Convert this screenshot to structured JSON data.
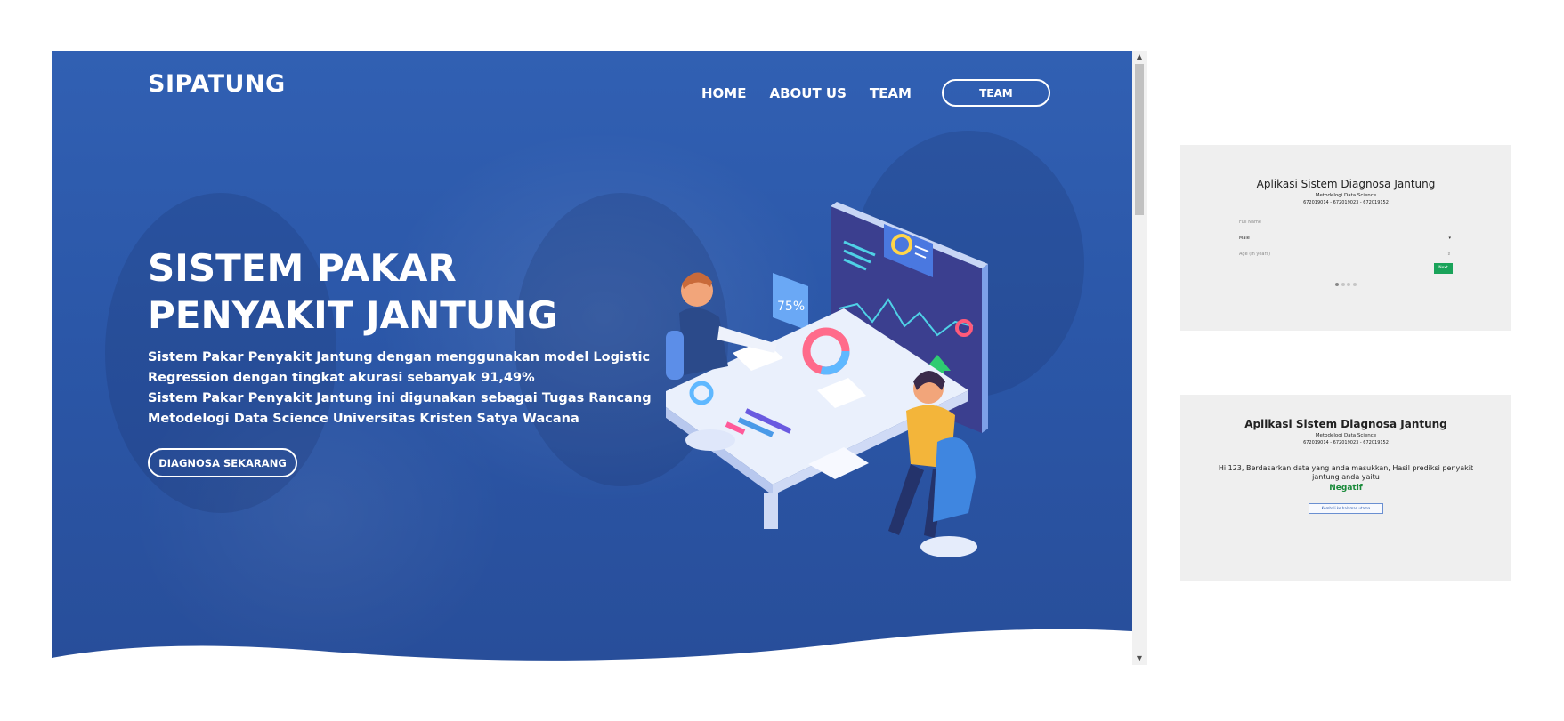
{
  "header": {
    "brand": "SIPATUNG",
    "nav": [
      {
        "label": "HOME"
      },
      {
        "label": "ABOUT US"
      },
      {
        "label": "TEAM"
      }
    ],
    "nav_button": "TEAM"
  },
  "hero": {
    "title_line1": "SISTEM PAKAR",
    "title_line2": "PENYAKIT JANTUNG",
    "desc_line1": "Sistem Pakar Penyakit Jantung dengan menggunakan model Logistic",
    "desc_line2": "Regression dengan tingkat akurasi sebanyak 91,49%",
    "desc_line3": "Sistem Pakar Penyakit Jantung ini digunakan sebagai Tugas Rancang",
    "desc_line4": "Metodelogi Data Science Universitas Kristen Satya Wacana",
    "cta": "DIAGNOSA SEKARANG",
    "illustration_badge": "75%"
  },
  "preview_form": {
    "title": "Aplikasi Sistem Diagnosa Jantung",
    "subtitle": "Metodelogi Data Science",
    "ids": "672019014 - 672019023 - 672019152",
    "fields": {
      "name_placeholder": "Full Name",
      "sex_value": "Male",
      "age_placeholder": "Age (in years)"
    },
    "next_label": "Next",
    "steps_total": 4,
    "step_active": 1
  },
  "preview_result": {
    "title": "Aplikasi Sistem Diagnosa Jantung",
    "subtitle": "Metodelogi Data Science",
    "ids": "672019014 - 672019023 - 672019152",
    "message": "Hi 123, Berdasarkan data yang anda masukkan, Hasil prediksi penyakit jantung anda yaitu",
    "result": "Negatif",
    "back_label": "Kembali ke halaman utama"
  },
  "colors": {
    "hero_blue": "#2b57a8",
    "next_green": "#1aa35a",
    "result_green": "#1a8a3a"
  },
  "icons": {
    "scroll_up": "triangle-up-icon",
    "scroll_down": "triangle-down-icon",
    "select_caret": "chevron-down-icon"
  }
}
